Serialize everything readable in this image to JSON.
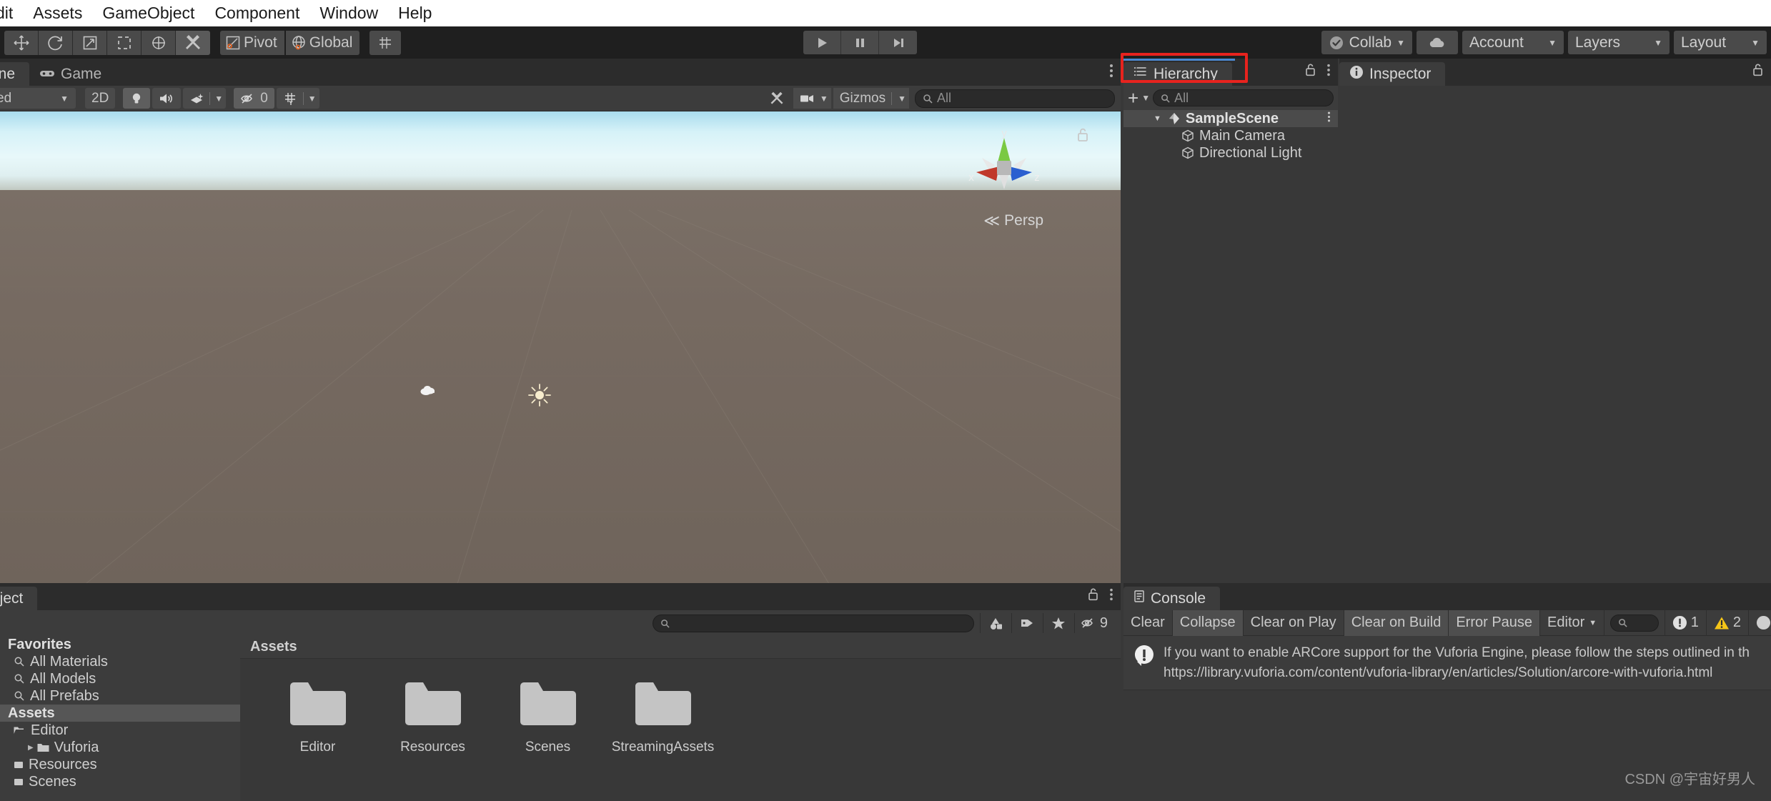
{
  "app": {
    "title": "Unity Editor",
    "watermark": "CSDN @宇宙好男人"
  },
  "menubar": {
    "items": [
      {
        "label": "dit",
        "name": "menu-edit"
      },
      {
        "label": "Assets",
        "name": "menu-assets"
      },
      {
        "label": "GameObject",
        "name": "menu-gameobject"
      },
      {
        "label": "Component",
        "name": "menu-component"
      },
      {
        "label": "Window",
        "name": "menu-window"
      },
      {
        "label": "Help",
        "name": "menu-help"
      }
    ]
  },
  "toolbar": {
    "tools": [
      {
        "name": "hand-tool",
        "icon": "move-arrows"
      },
      {
        "name": "rotate-tool",
        "icon": "rotate"
      },
      {
        "name": "scale-tool",
        "icon": "scale"
      },
      {
        "name": "rect-tool",
        "icon": "rect-transform"
      },
      {
        "name": "transform-tool",
        "icon": "transform"
      },
      {
        "name": "custom-tool",
        "icon": "wrench",
        "selected": true
      }
    ],
    "pivot_label": "Pivot",
    "global_label": "Global",
    "play_label": "Play",
    "pause_label": "Pause",
    "step_label": "Step",
    "collab_label": "Collab",
    "cloud_label": "",
    "account_label": "Account",
    "layers_label": "Layers",
    "layout_label": "Layout"
  },
  "scene": {
    "tabs": [
      {
        "label": "ene",
        "name": "tab-scene",
        "active": true,
        "icon": ""
      },
      {
        "label": "Game",
        "name": "tab-game",
        "active": false,
        "icon": "gamepad-icon"
      }
    ],
    "shading_mode": "ed",
    "toggle_2d": "2D",
    "hidden_count": "0",
    "gizmos_label": "Gizmos",
    "search_placeholder": "All",
    "view_mode": "Persp",
    "axis_labels": {
      "x": "x",
      "y": "y",
      "z": "z"
    }
  },
  "hierarchy": {
    "tab_label": "Hierarchy",
    "search_placeholder": "All",
    "add_label": "+",
    "items": [
      {
        "label": "SampleScene",
        "name": "hierarchy-item-samplescene",
        "depth": 0,
        "type": "scene",
        "expanded": true,
        "selected": true
      },
      {
        "label": "Main Camera",
        "name": "hierarchy-item-main-camera",
        "depth": 1,
        "type": "gameobject"
      },
      {
        "label": "Directional Light",
        "name": "hierarchy-item-directional-light",
        "depth": 1,
        "type": "gameobject"
      }
    ]
  },
  "inspector": {
    "tab_label": "Inspector"
  },
  "project": {
    "tab_label": "oject",
    "tree": [
      {
        "label": "Favorites",
        "name": "project-tree-favorites",
        "kind": "header",
        "depth": 0
      },
      {
        "label": "All Materials",
        "name": "project-tree-all-materials",
        "kind": "search",
        "depth": 1
      },
      {
        "label": "All Models",
        "name": "project-tree-all-models",
        "kind": "search",
        "depth": 1
      },
      {
        "label": "All Prefabs",
        "name": "project-tree-all-prefabs",
        "kind": "search",
        "depth": 1
      },
      {
        "label": "Assets",
        "name": "project-tree-assets",
        "kind": "header",
        "depth": 0,
        "selected": true
      },
      {
        "label": "Editor",
        "name": "project-tree-editor",
        "kind": "folder-open",
        "depth": 1
      },
      {
        "label": "Vuforia",
        "name": "project-tree-vuforia",
        "kind": "folder",
        "depth": 2,
        "has_arrow": true
      },
      {
        "label": "Resources",
        "name": "project-tree-resources",
        "kind": "folder",
        "depth": 1
      },
      {
        "label": "Scenes",
        "name": "project-tree-scenes",
        "kind": "folder",
        "depth": 1
      }
    ],
    "breadcrumb": "Assets",
    "search_placeholder": "",
    "hidden_count": "9",
    "folders": [
      {
        "label": "Editor",
        "name": "asset-folder-editor"
      },
      {
        "label": "Resources",
        "name": "asset-folder-resources"
      },
      {
        "label": "Scenes",
        "name": "asset-folder-scenes"
      },
      {
        "label": "StreamingAssets",
        "name": "asset-folder-streamingassets"
      }
    ]
  },
  "console": {
    "tab_label": "Console",
    "buttons": [
      {
        "label": "Clear",
        "name": "console-clear-button",
        "on": false
      },
      {
        "label": "Collapse",
        "name": "console-collapse-button",
        "on": true
      },
      {
        "label": "Clear on Play",
        "name": "console-clear-on-play-button",
        "on": false
      },
      {
        "label": "Clear on Build",
        "name": "console-clear-on-build-button",
        "on": true
      },
      {
        "label": "Error Pause",
        "name": "console-error-pause-button",
        "on": true
      }
    ],
    "editor_dropdown": "Editor",
    "search_placeholder": "",
    "counts": {
      "info": "1",
      "warning": "2",
      "error": ""
    },
    "messages": [
      {
        "name": "console-message-vuforia",
        "icon": "info-icon",
        "line1": "If you want to enable ARCore support for the Vuforia Engine, please follow the steps outlined in th",
        "line2": "https://library.vuforia.com/content/vuforia-library/en/articles/Solution/arcore-with-vuforia.html"
      }
    ]
  },
  "colors": {
    "accent_red": "#e8231e",
    "accent_blue": "#4b88d0",
    "warning_yellow": "#f5c518",
    "panel_bg": "#383838",
    "toolbar_bg": "#1f1f1f"
  }
}
